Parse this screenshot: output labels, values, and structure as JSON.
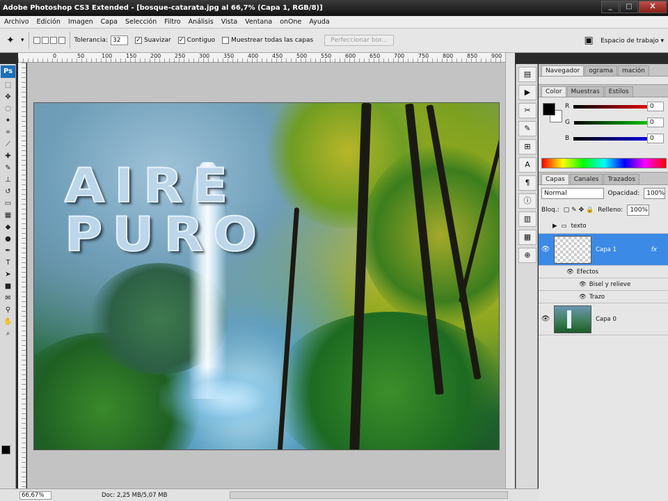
{
  "window": {
    "title": "Adobe Photoshop CS3 Extended - [bosque-catarata.jpg al 66,7% (Capa 1, RGB/8)]",
    "buttons": [
      "_",
      "□",
      "X"
    ]
  },
  "menu": [
    "Archivo",
    "Edición",
    "Imagen",
    "Capa",
    "Selección",
    "Filtro",
    "Análisis",
    "Vista",
    "Ventana",
    "onOne",
    "Ayuda"
  ],
  "options": {
    "tolerance_label": "Tolerancia:",
    "tolerance_value": "32",
    "suavizar_label": "Suavizar",
    "contiguo_label": "Contiguo",
    "muestrear_label": "Muestrear todas las capas",
    "refine_button": "Perfeccionar bor...",
    "workspace_label": "Espacio de trabajo ▾"
  },
  "ruler": {
    "marks": [
      "0",
      "50",
      "100",
      "150",
      "200",
      "250",
      "300",
      "350",
      "400",
      "450",
      "500",
      "550",
      "600",
      "650",
      "700",
      "750",
      "800",
      "850",
      "900"
    ]
  },
  "image": {
    "overlay_text_line1": "AIRE",
    "overlay_text_line2": "PURO"
  },
  "status": {
    "zoom": "66,67%",
    "doc": "Doc: 2,25 MB/5,07 MB"
  },
  "panels": {
    "top_tabs": [
      "Navegador",
      "ograma",
      "mación"
    ],
    "color_tabs": [
      "Color",
      "Muestras",
      "Estilos"
    ],
    "color": {
      "r_label": "R",
      "g_label": "G",
      "b_label": "B",
      "r_value": "0",
      "g_value": "0",
      "b_value": "0"
    },
    "layers_tabs": [
      "Capas",
      "Canales",
      "Trazados"
    ],
    "blend_mode": "Normal",
    "opacity_label": "Opacidad:",
    "opacity_value": "100%",
    "lock_label": "Bloq.:",
    "fill_label": "Relleno:",
    "fill_value": "100%",
    "layers": {
      "group": "texto",
      "capa1": "Capa 1",
      "fx": "fx",
      "effects": "Efectos",
      "bevel": "Bisel y relieve",
      "stroke": "Trazo",
      "capa0": "Capa 0"
    }
  },
  "tools": [
    "selection",
    "move",
    "lasso",
    "magic-wand",
    "crop",
    "slice",
    "healing",
    "brush",
    "stamp",
    "history-brush",
    "eraser",
    "gradient",
    "blur",
    "dodge",
    "pen",
    "type",
    "path-select",
    "shape",
    "notes",
    "eyedropper",
    "hand",
    "zoom"
  ]
}
